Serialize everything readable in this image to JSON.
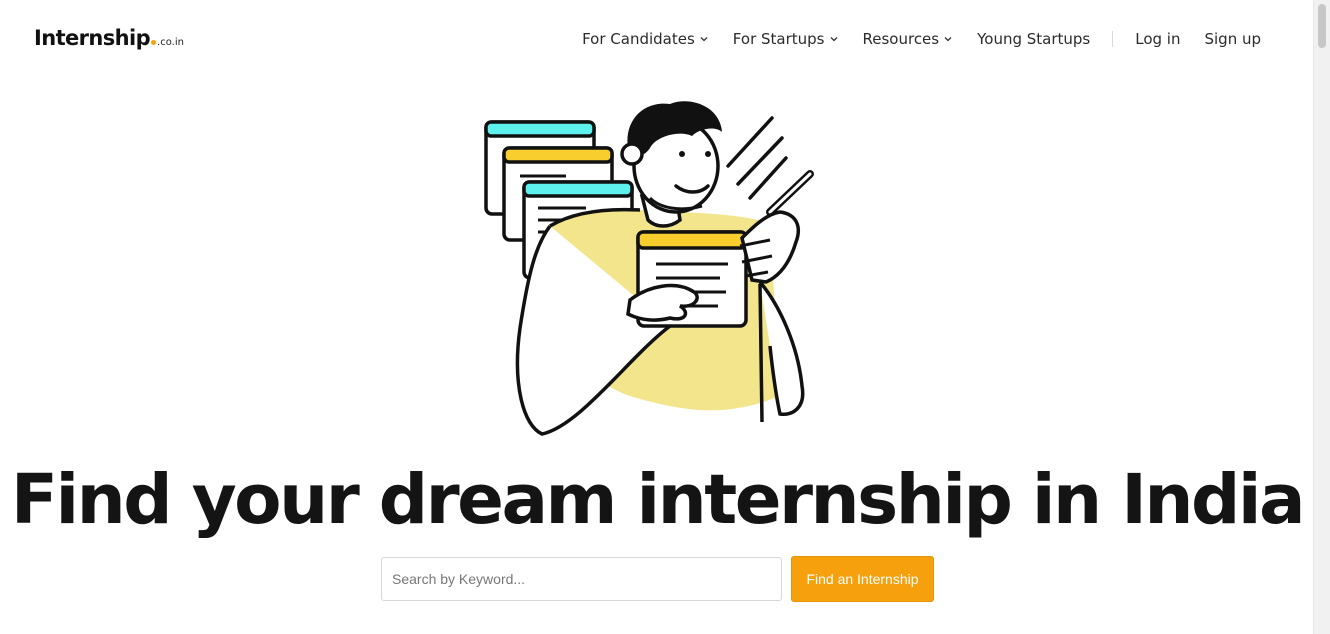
{
  "logo": {
    "name": "Internship",
    "tld": ".co.in"
  },
  "nav": {
    "items": [
      {
        "label": "For Candidates",
        "has_dropdown": true
      },
      {
        "label": "For Startups",
        "has_dropdown": true
      },
      {
        "label": "Resources",
        "has_dropdown": true
      },
      {
        "label": "Young Startups",
        "has_dropdown": false
      }
    ],
    "login": "Log in",
    "signup": "Sign up"
  },
  "hero": {
    "title": "Find your dream internship in India",
    "search_placeholder": "Search by Keyword...",
    "search_button": "Find an Internship"
  },
  "colors": {
    "accent": "#f5a00c",
    "illustration_yellow": "#f3e58c",
    "card_cyan": "#5ef0ec",
    "card_gold": "#f7ce2e",
    "text": "#141414"
  }
}
